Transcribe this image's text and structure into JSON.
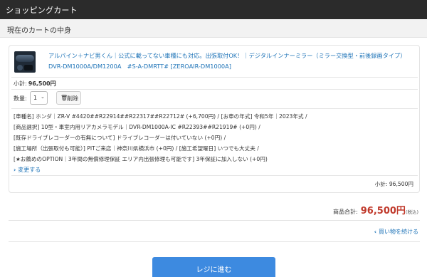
{
  "header": {
    "title": "ショッピングカート"
  },
  "section": {
    "title": "現在のカートの中身"
  },
  "item": {
    "image_icon": "dashcam-mirror-image",
    "title_line1": "アルパイン＋ナビ男くん｜公式に載ってない車種にも対応。出張取付OK！｜デジタルインナーミラー（ミラー交換型・前後録画タイプ）",
    "title_line2": "DVR-DM1000A/DM1200A　#S-A-DMRTT# [ZEROAIR-DM1000A]",
    "subtotal_label": "小計:",
    "subtotal_value": "96,500円",
    "quantity_label": "数量:",
    "quantity_value": "1",
    "quantity_chevron": "⌄",
    "delete_icon": "🗑",
    "delete_label": "削除",
    "options": [
      "[車種名] ホンダ｜ZR-V #4420##R22914##R22317##R22712# (+6,700円) / [お車の年式] 令和5年｜2023年式 /",
      "[商品選択] 10型・車室内用リアカメラモデル｜DVR-DM1000A-IC #R22393##R21919# (+0円) /",
      "[既存ドライブレコーダーの有無について] ドライブレコーダーは付いていない (+0円) /",
      "[施工場所（出張取付も可能）] PITご来店｜神奈川県横浜市 (+0円) / [施工希望曜日] いつでも大丈夫 /",
      "[★お薦めのOPTION｜3年間の無償修理保証 エリア内出張修理も可能です] 3年保証に加入しない (+0円)"
    ],
    "change_chevron": "›",
    "change_label": "変更する",
    "card_subtotal": "小計: 96,500円"
  },
  "summary": {
    "total_label": "商品合計:",
    "total_value": "96,500円",
    "tax_note": "(税込)"
  },
  "continue": {
    "chevron": "‹",
    "label": "買い物を続ける"
  },
  "checkout": {
    "label": "レジに進む"
  },
  "colors": {
    "link": "#1f74b8",
    "price": "#c0392b",
    "button": "#3d8ae0",
    "topbar": "#2b2b2b"
  }
}
